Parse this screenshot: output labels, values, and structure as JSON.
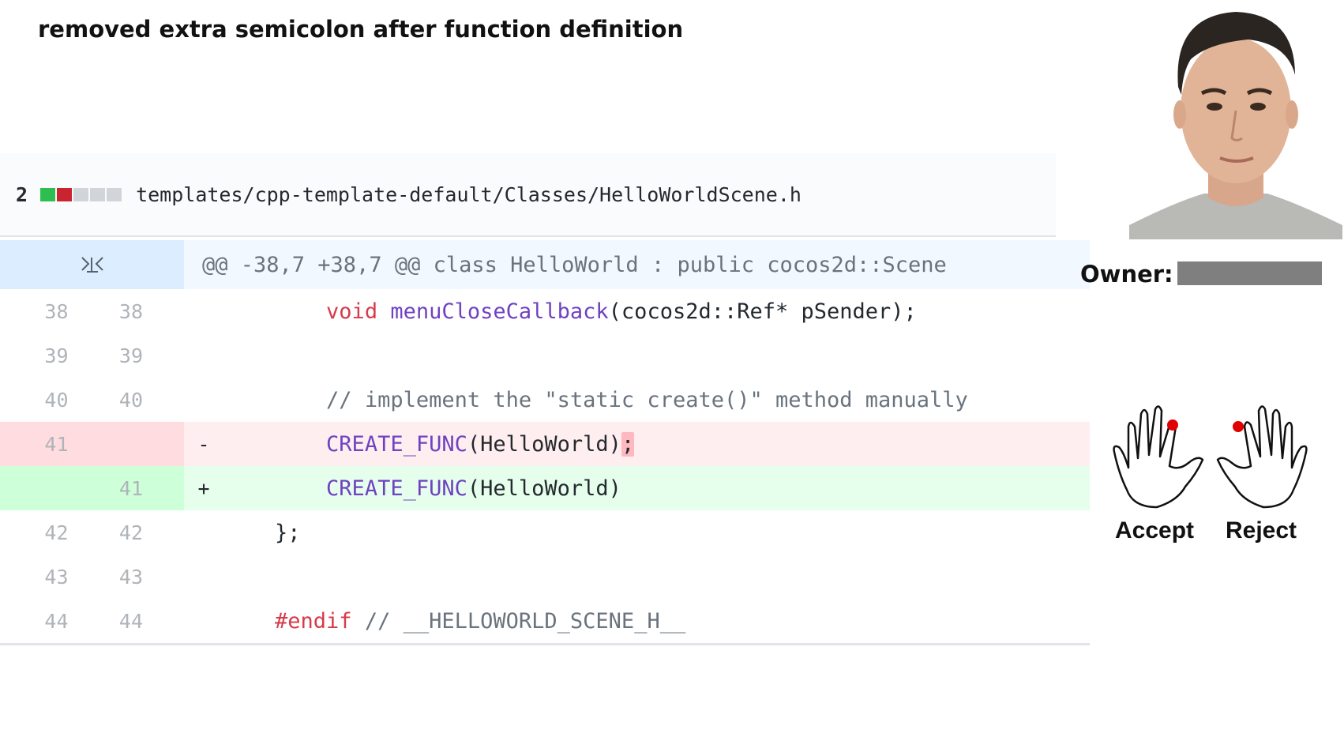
{
  "commit": {
    "title": "removed extra semicolon after function definition"
  },
  "file": {
    "change_count": "2",
    "path": "templates/cpp-template-default/Classes/HelloWorldScene.h",
    "diffstat_colors": [
      "#2cbe4e",
      "#cb2431",
      "#d1d5da",
      "#d1d5da",
      "#d1d5da"
    ]
  },
  "diff": {
    "hunk_header": "@@ -38,7 +38,7 @@ class HelloWorld : public cocos2d::Scene",
    "lines": [
      {
        "old": "38",
        "new": "38",
        "marker": "",
        "indent": "        ",
        "kw": "void ",
        "fn": "menuCloseCallback",
        "text": "(cocos2d::Ref* pSender);",
        "hl": "",
        "cm": ""
      },
      {
        "old": "39",
        "new": "39",
        "marker": "",
        "indent": "",
        "kw": "",
        "fn": "",
        "text": "",
        "hl": "",
        "cm": ""
      },
      {
        "old": "40",
        "new": "40",
        "marker": "",
        "indent": "        ",
        "kw": "",
        "fn": "",
        "text": "",
        "hl": "",
        "cm": "// implement the \"static create()\" method manually"
      },
      {
        "old": "41",
        "new": "",
        "marker": "-",
        "indent": "        ",
        "kw": "",
        "fn": "CREATE_FUNC",
        "text": "(HelloWorld)",
        "hl": ";",
        "cm": ""
      },
      {
        "old": "",
        "new": "41",
        "marker": "+",
        "indent": "        ",
        "kw": "",
        "fn": "CREATE_FUNC",
        "text": "(HelloWorld)",
        "hl": "",
        "cm": ""
      },
      {
        "old": "42",
        "new": "42",
        "marker": "",
        "indent": "    ",
        "kw": "",
        "fn": "",
        "text": "};",
        "hl": "",
        "cm": ""
      },
      {
        "old": "43",
        "new": "43",
        "marker": "",
        "indent": "",
        "kw": "",
        "fn": "",
        "text": "",
        "hl": "",
        "cm": ""
      },
      {
        "old": "44",
        "new": "44",
        "marker": "",
        "indent": "    ",
        "kw": "#endif ",
        "fn": "",
        "text": "",
        "hl": "",
        "cm": "// __HELLOWORLD_SCENE_H__"
      }
    ],
    "row_types": [
      "ctx",
      "ctx",
      "ctx",
      "del",
      "add",
      "ctx",
      "ctx",
      "ctx"
    ]
  },
  "owner": {
    "label": "Owner:"
  },
  "actions": {
    "accept_label": "Accept",
    "reject_label": "Reject"
  },
  "colors": {
    "accent_dot": "#e00000"
  }
}
